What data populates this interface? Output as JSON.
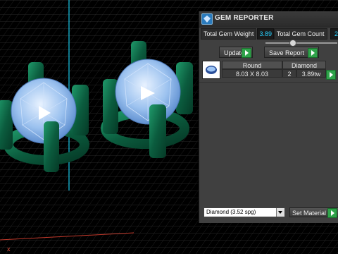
{
  "window": {
    "title": "GEM REPORTER"
  },
  "stats": {
    "weight_label": "Total Gem Weight",
    "weight_value": "3.89",
    "count_label": "Total Gem Count",
    "count_value": "2"
  },
  "buttons": {
    "update": "Update",
    "save_report": "Save Report"
  },
  "table": {
    "headers": [
      "Round",
      "Diamond"
    ],
    "row": {
      "size": "8.03 X 8.03",
      "count": "2",
      "weight": "3.89tw"
    }
  },
  "material": {
    "selected": "Diamond",
    "density": "(3.52 spg)",
    "set_label": "Set Material"
  },
  "colors": {
    "accent": "#28d0ff",
    "play_green": "#2fa34a",
    "prong_green": "#0d6b4a",
    "gem_blue": "#8db9ec"
  },
  "icons": [
    "gem-app-icon",
    "play-icon",
    "gem-thumbnail-icon",
    "dropdown-arrow-icon"
  ]
}
